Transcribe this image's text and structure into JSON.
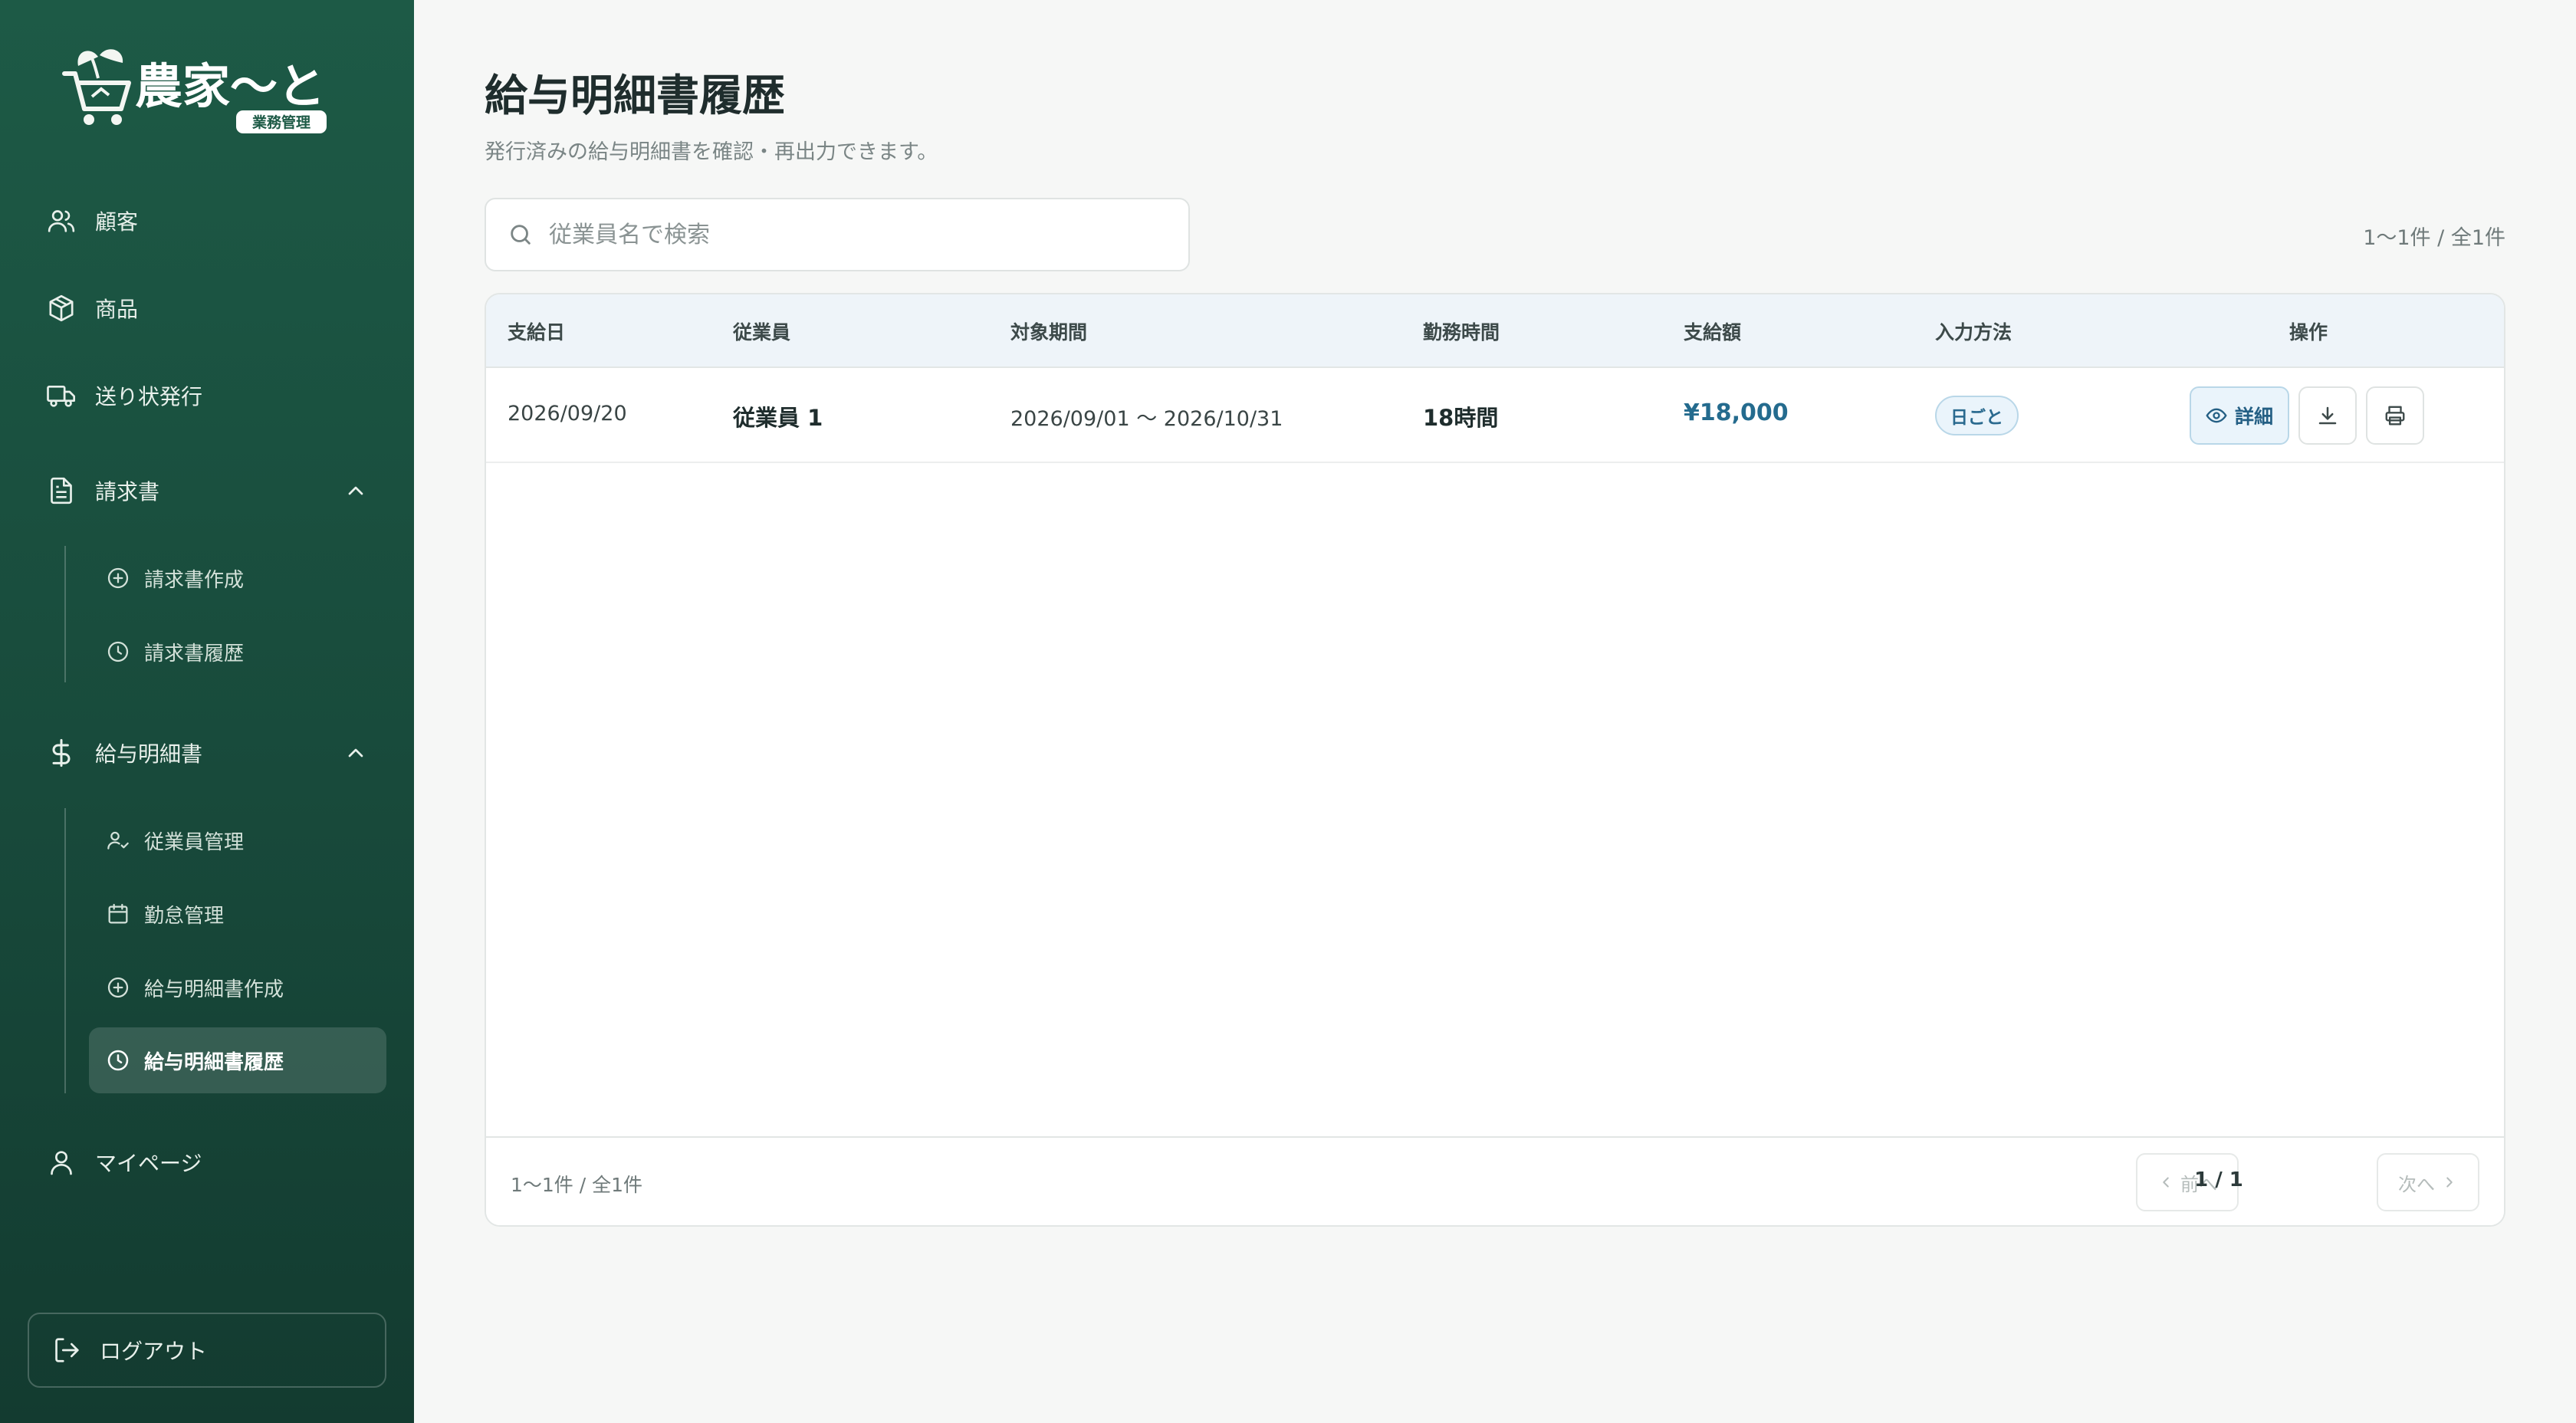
{
  "brand": {
    "name": "農家〜と",
    "tag": "業務管理"
  },
  "sidebar": {
    "items": [
      {
        "label": "顧客",
        "icon": "users-icon"
      },
      {
        "label": "商品",
        "icon": "package-icon"
      },
      {
        "label": "送り状発行",
        "icon": "truck-icon"
      },
      {
        "label": "請求書",
        "icon": "file-text-icon",
        "expanded": true,
        "children": [
          {
            "label": "請求書作成",
            "icon": "plus-circle-icon"
          },
          {
            "label": "請求書履歴",
            "icon": "clock-icon"
          }
        ]
      },
      {
        "label": "給与明細書",
        "icon": "dollar-icon",
        "expanded": true,
        "children": [
          {
            "label": "従業員管理",
            "icon": "user-check-icon"
          },
          {
            "label": "勤怠管理",
            "icon": "calendar-icon"
          },
          {
            "label": "給与明細書作成",
            "icon": "plus-circle-icon"
          },
          {
            "label": "給与明細書履歴",
            "icon": "clock-icon",
            "active": true
          }
        ]
      },
      {
        "label": "マイページ",
        "icon": "user-icon"
      }
    ],
    "logout": "ログアウト"
  },
  "page": {
    "title": "給与明細書履歴",
    "subtitle": "発行済みの給与明細書を確認・再出力できます。"
  },
  "search": {
    "placeholder": "従業員名で検索",
    "value": ""
  },
  "result_count": "1〜1件 / 全1件",
  "table": {
    "headers": [
      "支給日",
      "従業員",
      "対象期間",
      "勤務時間",
      "支給額",
      "入力方法",
      "操作"
    ],
    "rows": [
      {
        "pay_date": "2026/09/20",
        "employee": "従業員 1",
        "period": "2026/09/01 〜 2026/10/31",
        "hours": "18時間",
        "amount": "¥18,000",
        "input_method": "日ごと",
        "detail_label": "詳細"
      }
    ]
  },
  "pagination": {
    "prev": "前へ",
    "page_info": "1 / 1",
    "next": "次へ"
  },
  "colors": {
    "sidebar_top": "#1d5a46",
    "sidebar_bottom": "#133b30",
    "accent_blue": "#246b8e"
  }
}
